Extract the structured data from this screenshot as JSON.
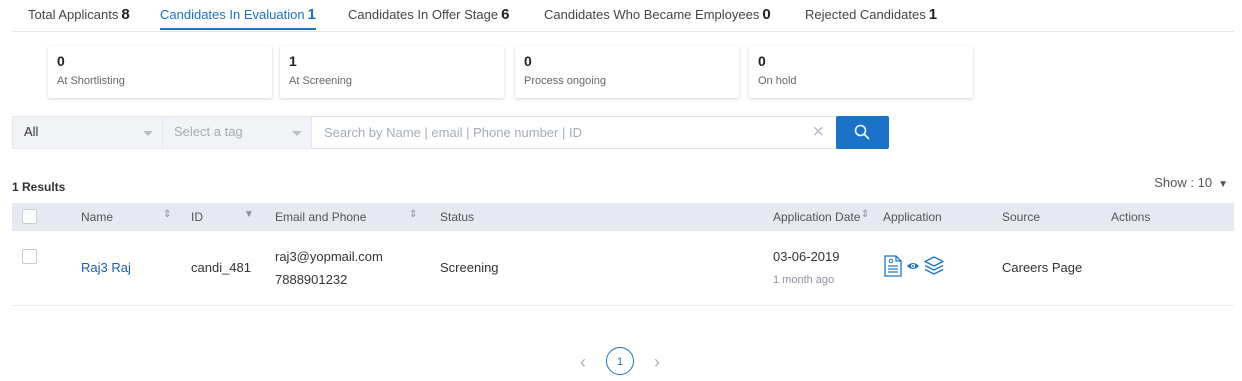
{
  "tabs": [
    {
      "label": "Total Applicants",
      "count": "8"
    },
    {
      "label": "Candidates In Evaluation",
      "count": "1"
    },
    {
      "label": "Candidates In Offer Stage",
      "count": "6"
    },
    {
      "label": "Candidates Who Became Employees",
      "count": "0"
    },
    {
      "label": "Rejected Candidates",
      "count": "1"
    }
  ],
  "active_tab_index": 1,
  "stage_cards": [
    {
      "value": "0",
      "label": "At Shortlisting"
    },
    {
      "value": "1",
      "label": "At Screening"
    },
    {
      "value": "0",
      "label": "Process ongoing"
    },
    {
      "value": "0",
      "label": "On hold"
    }
  ],
  "filters": {
    "status_select": "All",
    "tag_select": "Select a tag",
    "search_placeholder": "Search by Name | email | Phone number | ID",
    "clear_icon": "×"
  },
  "results_text": "1 Results",
  "show": {
    "label": "Show : ",
    "value": "10",
    "arrow": "▼"
  },
  "table": {
    "headers": {
      "name": "Name",
      "id": "ID",
      "email_phone": "Email and Phone",
      "status": "Status",
      "application_date": "Application Date",
      "application": "Application",
      "source": "Source",
      "actions": "Actions"
    },
    "sort_icon": "⇕",
    "filter_icon": "▼",
    "rows": [
      {
        "name": "Raj3 Raj",
        "id": "candi_481",
        "email": "raj3@yopmail.com",
        "phone": "7888901232",
        "status": "Screening",
        "date": "03-06-2019",
        "relative": "1 month ago",
        "source": "Careers Page"
      }
    ]
  },
  "pagination": {
    "prev": "‹",
    "current": "1",
    "next": "›"
  },
  "colors": {
    "accent": "#1a73c8",
    "link": "#1a5fb4",
    "header_bg": "#e6e9f1"
  },
  "icons": [
    "resume-icon",
    "eye-icon",
    "layers-icon",
    "search-icon",
    "close-icon",
    "chevron-left-icon",
    "chevron-right-icon"
  ]
}
